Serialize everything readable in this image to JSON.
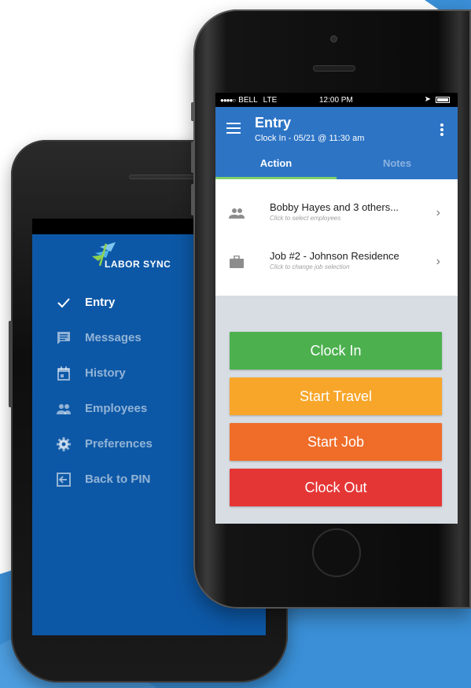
{
  "drawer": {
    "logo_text": "LABOR SYNC",
    "items": [
      {
        "label": "Entry",
        "icon": "check-icon",
        "active": true
      },
      {
        "label": "Messages",
        "icon": "message-icon",
        "active": false
      },
      {
        "label": "History",
        "icon": "calendar-icon",
        "active": false
      },
      {
        "label": "Employees",
        "icon": "people-icon",
        "active": false
      },
      {
        "label": "Preferences",
        "icon": "gear-icon",
        "active": false
      },
      {
        "label": "Back to PIN",
        "icon": "exit-icon",
        "active": false
      }
    ]
  },
  "status_bar": {
    "signal": "●●●●○",
    "carrier": "BELL",
    "network": "LTE",
    "time": "12:00 PM"
  },
  "header": {
    "title": "Entry",
    "subtitle": "Clock In - 05/21 @ 11:30 am",
    "tabs": [
      {
        "label": "Action",
        "active": true
      },
      {
        "label": "Notes",
        "active": false
      }
    ]
  },
  "selections": [
    {
      "title": "Bobby Hayes and 3 others...",
      "hint": "Click to select employees",
      "icon": "people-icon"
    },
    {
      "title": "Job #2 - Johnson Residence",
      "hint": "Click to change job selection",
      "icon": "briefcase-icon"
    }
  ],
  "actions": [
    {
      "label": "Clock In",
      "color": "#4cb04f"
    },
    {
      "label": "Start Travel",
      "color": "#f8a62a"
    },
    {
      "label": "Start Job",
      "color": "#ef6d29"
    },
    {
      "label": "Clock Out",
      "color": "#e53636"
    }
  ],
  "colors": {
    "header_blue": "#2d74c5",
    "drawer_blue": "#0d58a6",
    "tab_indicator": "#7fd06a",
    "content_bg": "#d7dde3",
    "background_accent": "#3a8fd6"
  }
}
